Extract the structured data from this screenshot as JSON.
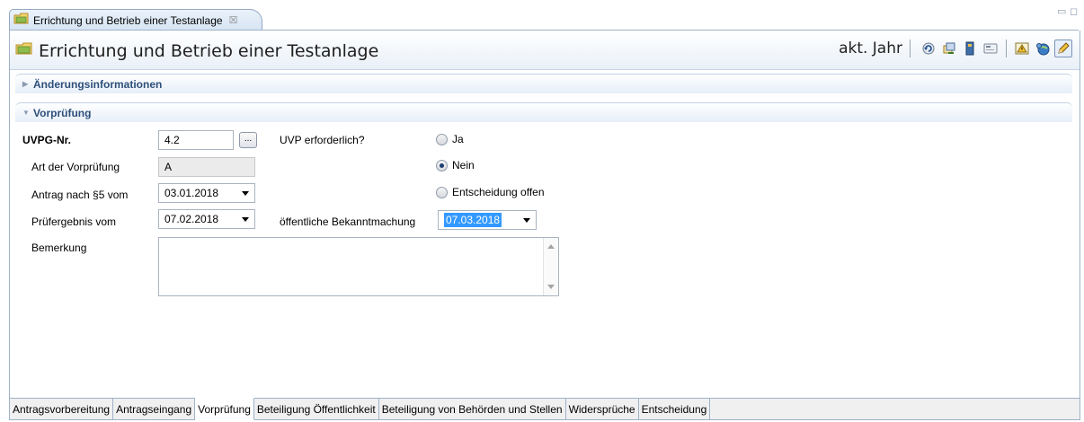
{
  "editor_tab": {
    "title": "Errichtung und Betrieb einer Testanlage",
    "close": "☒"
  },
  "window_controls": {
    "minimize": "▭",
    "maximize": "◻"
  },
  "header": {
    "title": "Errichtung und Betrieb einer Testanlage",
    "year_label": "akt. Jahr",
    "toolbar": [
      {
        "name": "undo-icon",
        "glyph": "↶"
      },
      {
        "name": "refresh-docs-icon",
        "glyph": "⟳"
      },
      {
        "name": "book-icon",
        "glyph": "▮"
      },
      {
        "name": "card-icon",
        "glyph": "▭"
      },
      {
        "name": "warning-icon",
        "glyph": "⚠"
      },
      {
        "name": "globe-icon",
        "glyph": "◍"
      },
      {
        "name": "edit-pencil-icon",
        "glyph": "✎"
      }
    ]
  },
  "sections": {
    "changes": {
      "label": "Änderungsinformationen",
      "arrow": "▶"
    },
    "prereview": {
      "label": "Vorprüfung",
      "arrow": "▼"
    }
  },
  "form": {
    "uvpg_label": "UVPG-Nr.",
    "uvpg_value": "4.2",
    "browse_label": "...",
    "art_label": "Art der Vorprüfung",
    "art_value": "A",
    "antrag_label": "Antrag nach §5 vom",
    "antrag_value": "03.01.2018",
    "pruef_label": "Prüfergebnis vom",
    "pruef_value": "07.02.2018",
    "uvp_label": "UVP erforderlich?",
    "radio_options": [
      "Ja",
      "Nein",
      "Entscheidung offen"
    ],
    "radio_selected": "Nein",
    "bekannt_label": "öffentliche Bekanntmachung",
    "bekannt_value": "07.03.2018",
    "bemerkung_label": "Bemerkung",
    "bemerkung_value": ""
  },
  "bottom_tabs": [
    "Antragsvorbereitung",
    "Antragseingang",
    "Vorprüfung",
    "Beteiligung Öffentlichkeit",
    "Beteiligung von Behörden und Stellen",
    "Widersprüche",
    "Entscheidung"
  ],
  "active_bottom_tab": "Vorprüfung"
}
